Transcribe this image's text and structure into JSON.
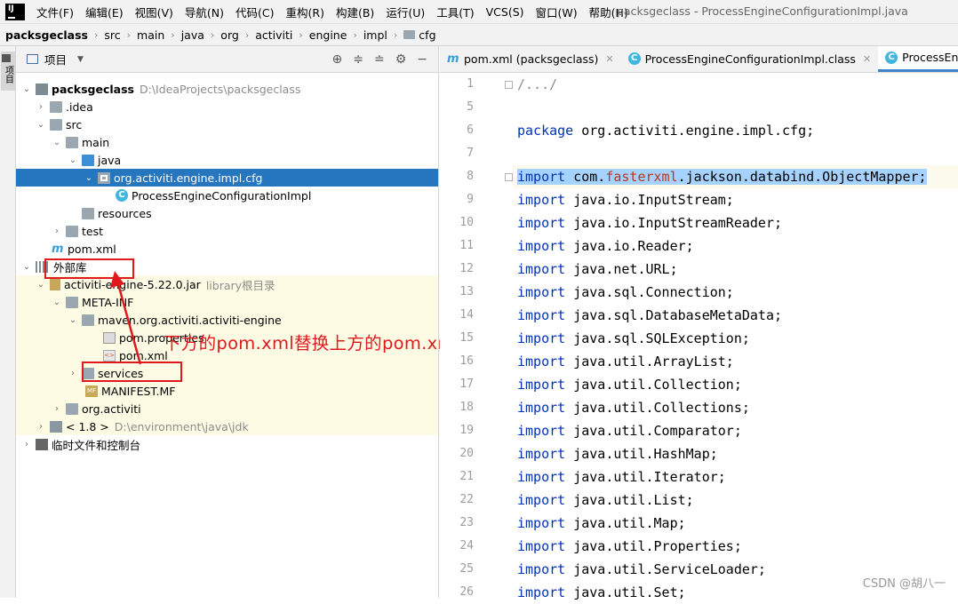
{
  "menubar": {
    "logo": "IJ",
    "items": [
      "文件(F)",
      "编辑(E)",
      "视图(V)",
      "导航(N)",
      "代码(C)",
      "重构(R)",
      "构建(B)",
      "运行(U)",
      "工具(T)",
      "VCS(S)",
      "窗口(W)",
      "帮助(H)"
    ],
    "window_title": "packsgeclass - ProcessEngineConfigurationImpl.java"
  },
  "breadcrumb": [
    "packsgeclass",
    "src",
    "main",
    "java",
    "org",
    "activiti",
    "engine",
    "impl",
    "cfg"
  ],
  "sidebar": {
    "tab_label": "项目"
  },
  "project_panel": {
    "title": "项目",
    "tree": [
      {
        "label": "packsgeclass",
        "hint": "D:\\IdeaProjects\\packsgeclass"
      },
      {
        "label": ".idea"
      },
      {
        "label": "src"
      },
      {
        "label": "main"
      },
      {
        "label": "java"
      },
      {
        "label": "org.activiti.engine.impl.cfg"
      },
      {
        "label": "ProcessEngineConfigurationImpl"
      },
      {
        "label": "resources"
      },
      {
        "label": "test"
      },
      {
        "label": "pom.xml"
      },
      {
        "label": "外部库"
      },
      {
        "label": "activiti-engine-5.22.0.jar",
        "hint": "library根目录"
      },
      {
        "label": "META-INF"
      },
      {
        "label": "maven.org.activiti.activiti-engine"
      },
      {
        "label": "pom.properties"
      },
      {
        "label": "pom.xml"
      },
      {
        "label": "services"
      },
      {
        "label": "MANIFEST.MF"
      },
      {
        "label": "org.activiti"
      },
      {
        "label": "< 1.8 >",
        "hint": "D:\\environment\\java\\jdk"
      },
      {
        "label": "临时文件和控制台"
      }
    ],
    "annotation": "下方的pom.xml替换上方的pom.xml"
  },
  "editor": {
    "tabs": [
      {
        "label": "pom.xml (packsgeclass)",
        "icon": "m"
      },
      {
        "label": "ProcessEngineConfigurationImpl.class",
        "icon": "C"
      },
      {
        "label": "ProcessEngineCo",
        "icon": "C"
      }
    ],
    "lines": [
      {
        "n": "1",
        "text": "/.../"
      },
      {
        "n": "5",
        "text": ""
      },
      {
        "n": "6",
        "text": "package org.activiti.engine.impl.cfg;"
      },
      {
        "n": "7",
        "text": ""
      },
      {
        "n": "8",
        "text": "import com.fasterxml.jackson.databind.ObjectMapper;"
      },
      {
        "n": "9",
        "text": "import java.io.InputStream;"
      },
      {
        "n": "10",
        "text": "import java.io.InputStreamReader;"
      },
      {
        "n": "11",
        "text": "import java.io.Reader;"
      },
      {
        "n": "12",
        "text": "import java.net.URL;"
      },
      {
        "n": "13",
        "text": "import java.sql.Connection;"
      },
      {
        "n": "14",
        "text": "import java.sql.DatabaseMetaData;"
      },
      {
        "n": "15",
        "text": "import java.sql.SQLException;"
      },
      {
        "n": "16",
        "text": "import java.util.ArrayList;"
      },
      {
        "n": "17",
        "text": "import java.util.Collection;"
      },
      {
        "n": "18",
        "text": "import java.util.Collections;"
      },
      {
        "n": "19",
        "text": "import java.util.Comparator;"
      },
      {
        "n": "20",
        "text": "import java.util.HashMap;"
      },
      {
        "n": "21",
        "text": "import java.util.Iterator;"
      },
      {
        "n": "22",
        "text": "import java.util.List;"
      },
      {
        "n": "23",
        "text": "import java.util.Map;"
      },
      {
        "n": "24",
        "text": "import java.util.Properties;"
      },
      {
        "n": "25",
        "text": "import java.util.ServiceLoader;"
      },
      {
        "n": "26",
        "text": "import java.util.Set;"
      }
    ]
  },
  "watermark": "CSDN @胡八一"
}
